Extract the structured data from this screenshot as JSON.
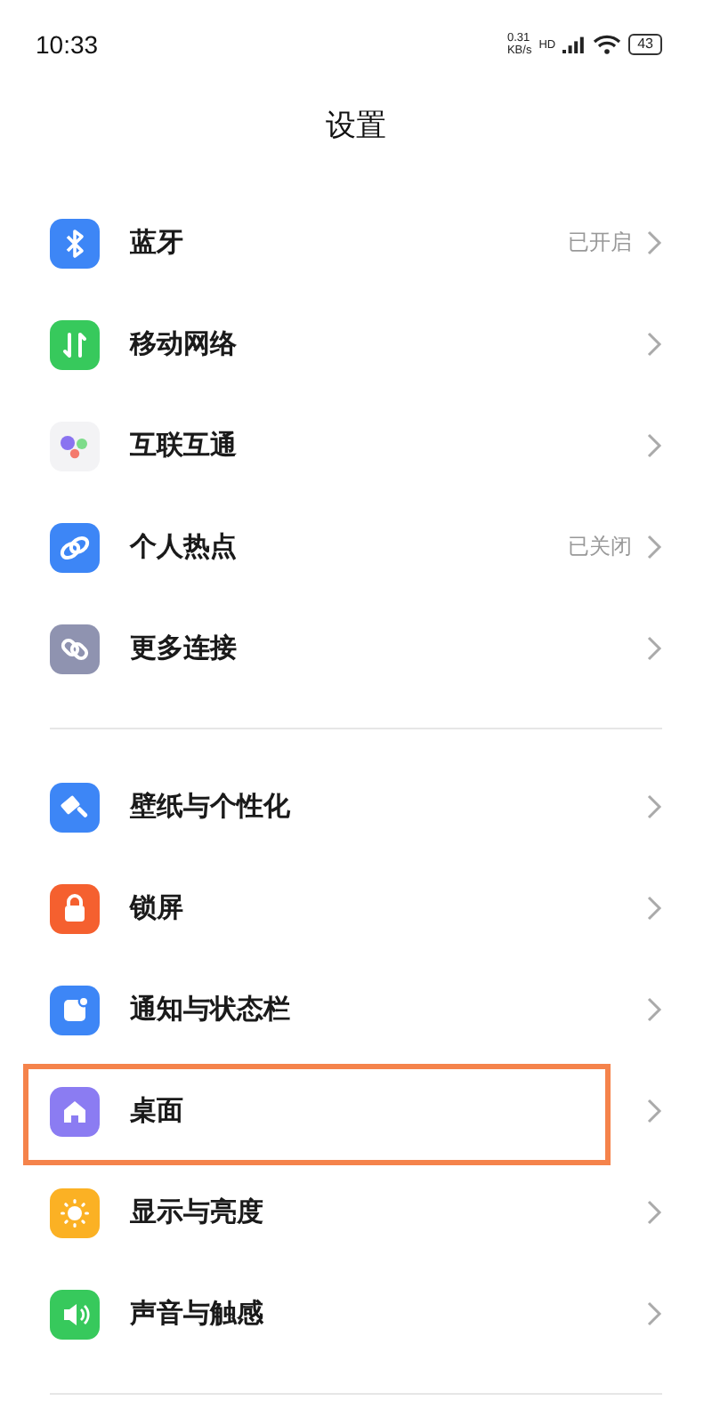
{
  "status_bar": {
    "time": "10:33",
    "speed_value": "0.31",
    "speed_unit": "KB/s",
    "network_tag": "HD",
    "battery": "43"
  },
  "title": "设置",
  "groups": [
    {
      "items": [
        {
          "kind": "bluetooth",
          "label": "蓝牙",
          "value": "已开启",
          "highlighted": false
        },
        {
          "kind": "mobile-data",
          "label": "移动网络",
          "highlighted": false
        },
        {
          "kind": "connect",
          "label": "互联互通",
          "highlighted": false
        },
        {
          "kind": "hotspot",
          "label": "个人热点",
          "value": "已关闭",
          "highlighted": false
        },
        {
          "kind": "link",
          "label": "更多连接",
          "highlighted": false
        }
      ]
    },
    {
      "items": [
        {
          "kind": "wallpaper",
          "label": "壁纸与个性化",
          "highlighted": false
        },
        {
          "kind": "lock",
          "label": "锁屏",
          "highlighted": false
        },
        {
          "kind": "notification",
          "label": "通知与状态栏",
          "highlighted": false
        },
        {
          "kind": "home",
          "label": "桌面",
          "highlighted": true
        },
        {
          "kind": "display",
          "label": "显示与亮度",
          "highlighted": false
        },
        {
          "kind": "sound",
          "label": "声音与触感",
          "highlighted": false
        }
      ]
    }
  ]
}
